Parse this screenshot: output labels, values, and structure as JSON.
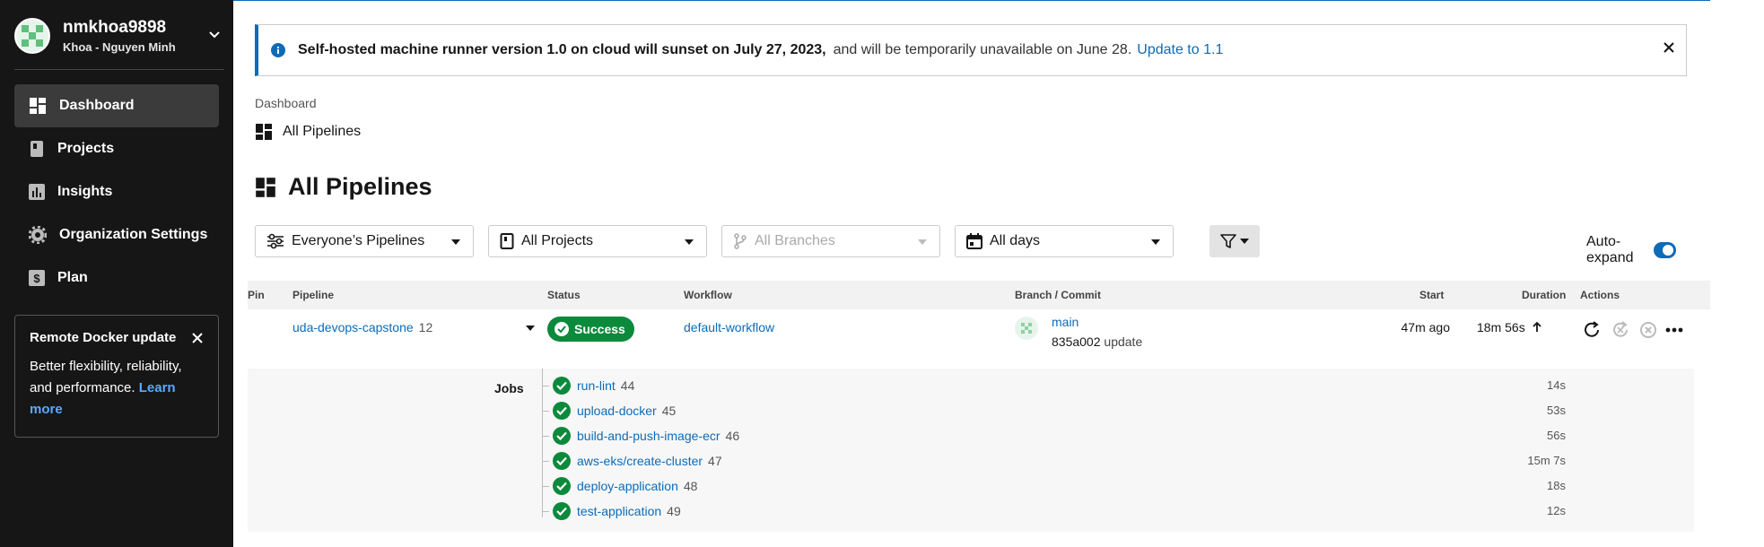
{
  "user": {
    "name": "nmkhoa9898",
    "full_name": "Khoa - Nguyen Minh"
  },
  "nav": {
    "items": [
      {
        "label": "Dashboard",
        "icon": "dashboard-icon",
        "active": true
      },
      {
        "label": "Projects",
        "icon": "book-icon"
      },
      {
        "label": "Insights",
        "icon": "bar-chart-icon"
      },
      {
        "label": "Organization Settings",
        "icon": "gear-icon"
      },
      {
        "label": "Plan",
        "icon": "dollar-icon"
      }
    ]
  },
  "promo": {
    "title": "Remote Docker update",
    "body": "Better flexibility, reliability, and performance.",
    "link": "Learn more"
  },
  "banner": {
    "bold": "Self-hosted machine runner version 1.0 on cloud will sunset on July 27, 2023,",
    "rest": "and will be temporarily unavailable on June 28.",
    "link": "Update to 1.1"
  },
  "breadcrumb": {
    "parent": "Dashboard",
    "current": "All Pipelines"
  },
  "page_title": "All Pipelines",
  "filters": {
    "pipelines": "Everyone’s Pipelines",
    "projects": "All Projects",
    "branches": "All Branches",
    "days": "All days",
    "auto_expand_label": "Auto-expand",
    "auto_expand_on": true
  },
  "table": {
    "headers": {
      "pin": "Pin",
      "pipeline": "Pipeline",
      "status": "Status",
      "workflow": "Workflow",
      "branch": "Branch / Commit",
      "start": "Start",
      "duration": "Duration",
      "actions": "Actions"
    },
    "row": {
      "pipeline": "uda-devops-capstone",
      "pipeline_num": "12",
      "status": "Success",
      "workflow": "default-workflow",
      "branch": "main",
      "commit_hash": "835a002",
      "commit_msg": "update",
      "start": "47m ago",
      "duration": "18m 56s"
    }
  },
  "jobs": {
    "label": "Jobs",
    "items": [
      {
        "name": "run-lint",
        "num": "44",
        "duration": "14s"
      },
      {
        "name": "upload-docker",
        "num": "45",
        "duration": "53s"
      },
      {
        "name": "build-and-push-image-ecr",
        "num": "46",
        "duration": "56s"
      },
      {
        "name": "aws-eks/create-cluster",
        "num": "47",
        "duration": "15m 7s"
      },
      {
        "name": "deploy-application",
        "num": "48",
        "duration": "18s"
      },
      {
        "name": "test-application",
        "num": "49",
        "duration": "12s"
      }
    ]
  },
  "colors": {
    "accent": "#0d6bb8",
    "success": "#0b8a3c",
    "sidebar": "#161616"
  }
}
